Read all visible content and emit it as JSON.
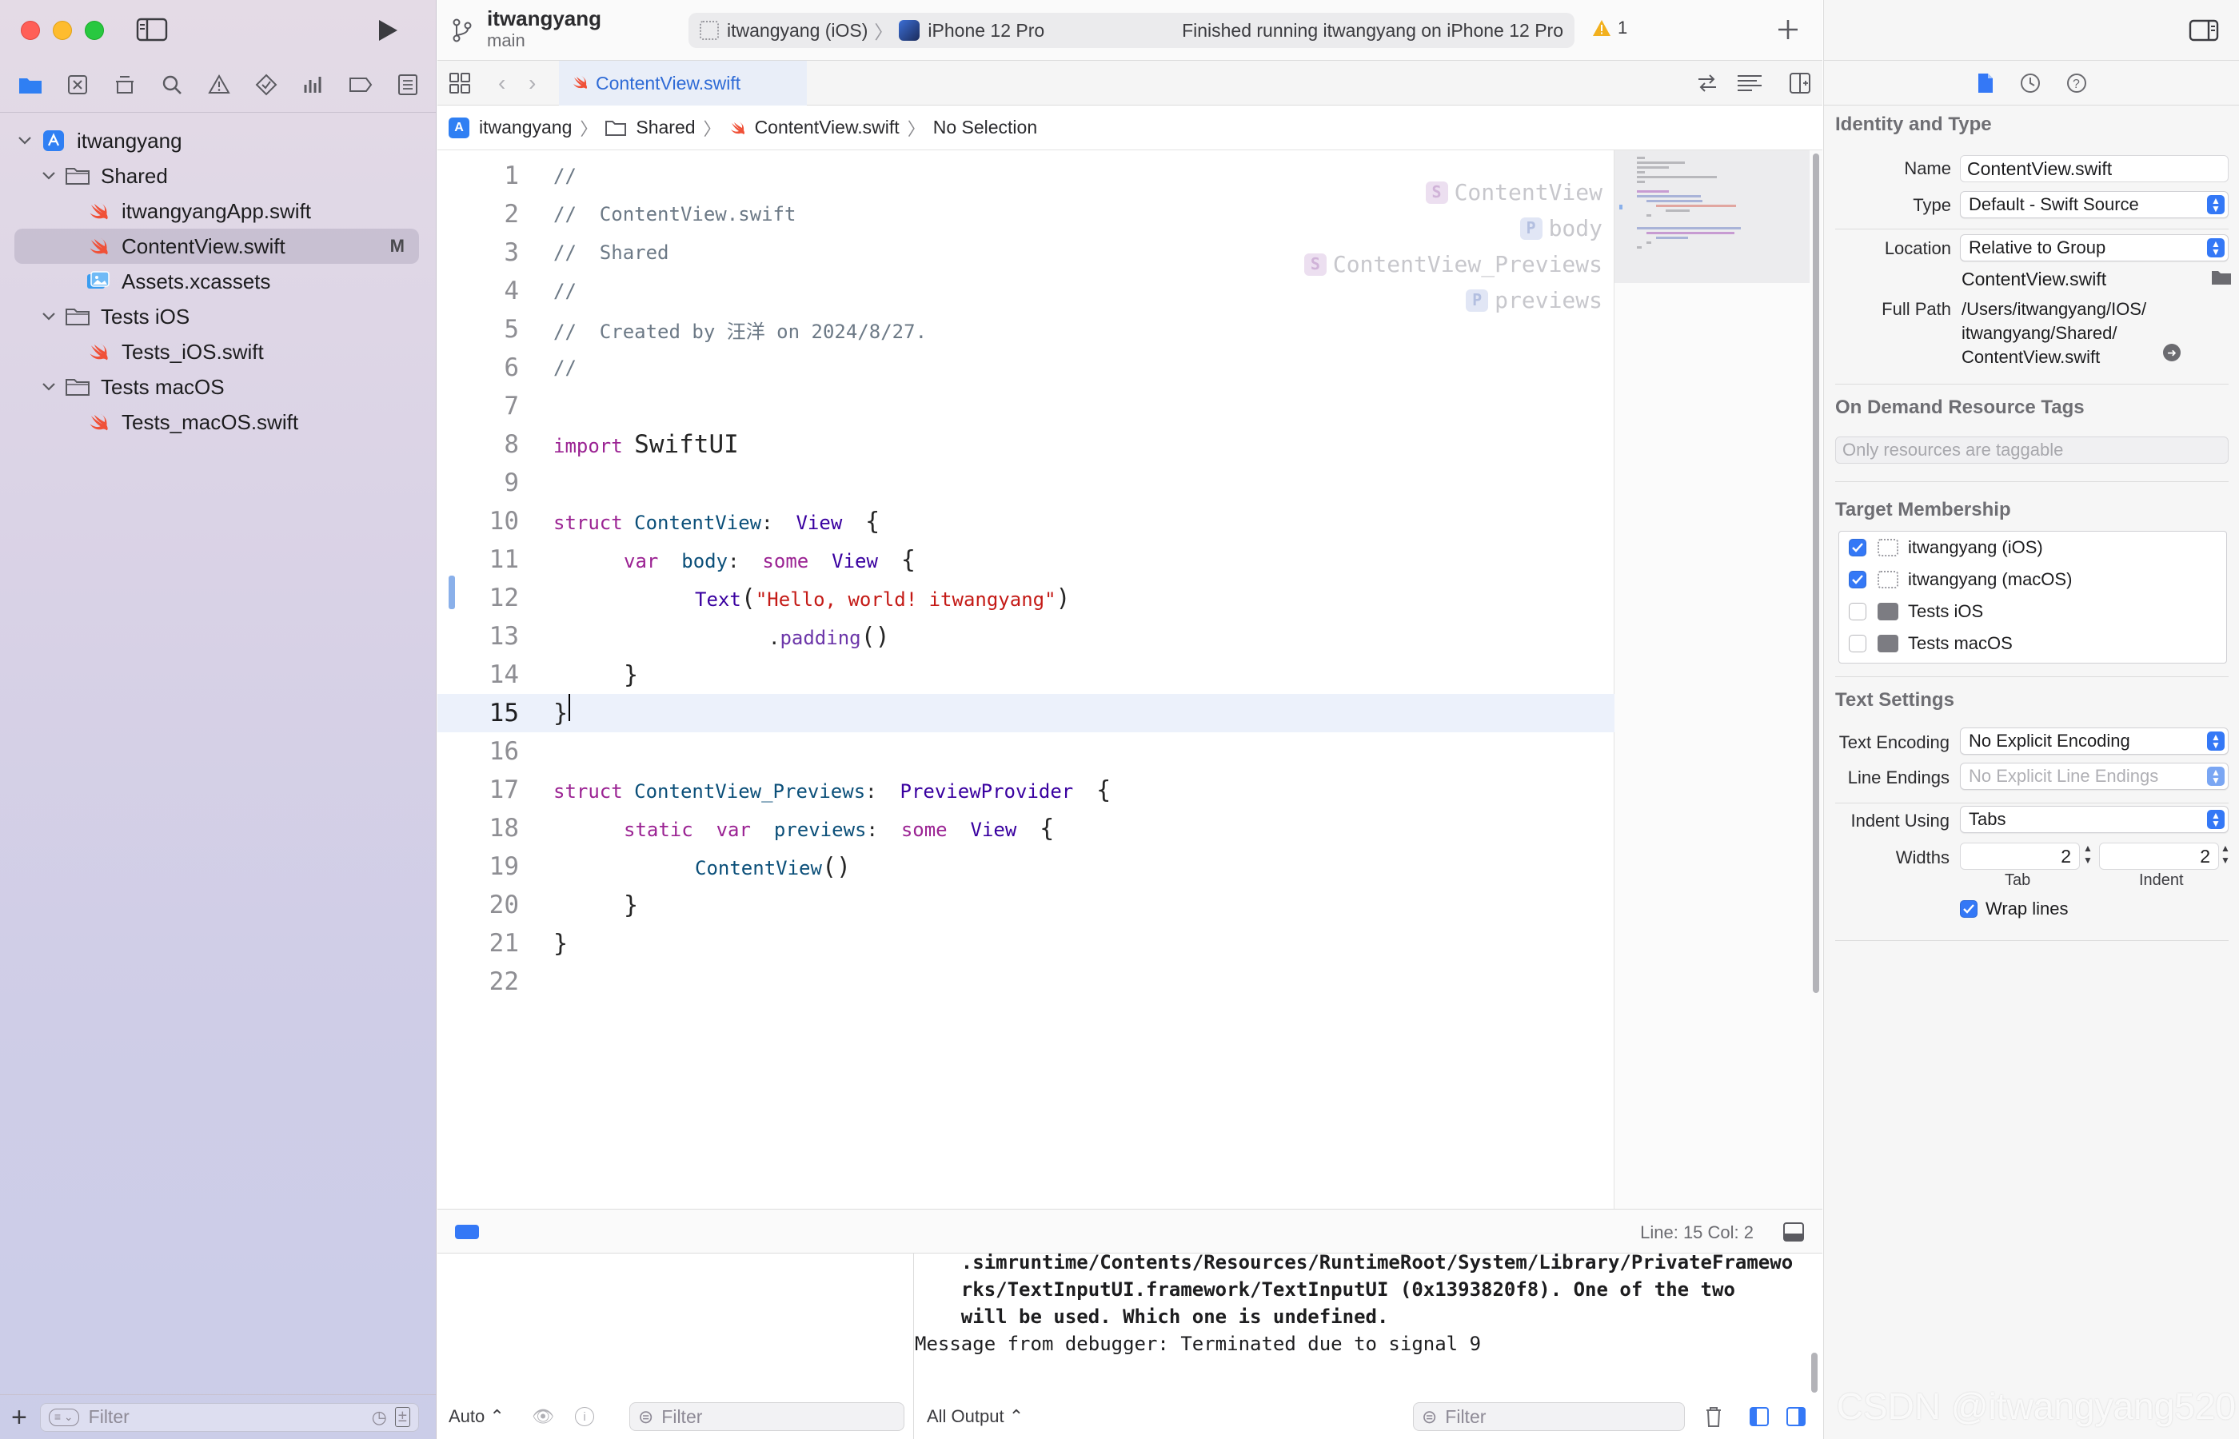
{
  "project": {
    "name": "itwangyang",
    "branch": "main"
  },
  "scheme": {
    "target": "itwangyang (iOS)",
    "device": "iPhone 12 Pro",
    "status": "Finished running itwangyang on iPhone 12 Pro",
    "warnings": "1"
  },
  "navigator": {
    "items": [
      {
        "label": "itwangyang",
        "icon": "project-icon",
        "level": 0
      },
      {
        "label": "Shared",
        "icon": "folder-icon",
        "level": 1
      },
      {
        "label": "itwangyangApp.swift",
        "icon": "swift-icon",
        "level": 2
      },
      {
        "label": "ContentView.swift",
        "icon": "swift-icon",
        "level": 2,
        "badge": "M",
        "selected": true
      },
      {
        "label": "Assets.xcassets",
        "icon": "assets-icon",
        "level": 2
      },
      {
        "label": "Tests iOS",
        "icon": "folder-icon",
        "level": 1
      },
      {
        "label": "Tests_iOS.swift",
        "icon": "swift-icon",
        "level": 2
      },
      {
        "label": "Tests macOS",
        "icon": "folder-icon",
        "level": 1
      },
      {
        "label": "Tests_macOS.swift",
        "icon": "swift-icon",
        "level": 2
      }
    ],
    "filter_placeholder": "Filter"
  },
  "editor": {
    "tab_label": "ContentView.swift",
    "breadcrumb": [
      "itwangyang",
      "Shared",
      "ContentView.swift",
      "No Selection"
    ],
    "line_numbers": [
      "1",
      "2",
      "3",
      "4",
      "5",
      "6",
      "7",
      "8",
      "9",
      "10",
      "11",
      "12",
      "13",
      "14",
      "15",
      "16",
      "17",
      "18",
      "19",
      "20",
      "21",
      "22"
    ],
    "code": {
      "l1": "//",
      "l2": "//  ContentView.swift",
      "l3": "//  Shared",
      "l4": "//",
      "l5": "//  Created by 汪洋 on 2024/8/27.",
      "l6": "//",
      "l8_kw": "import",
      "l8_mod": "SwiftUI",
      "kw_struct": "struct",
      "kw_var": "var",
      "kw_some": "some",
      "kw_static": "static",
      "t_view": "View",
      "t_contentview": "ContentView",
      "t_previews_struct": "ContentView_Previews",
      "t_previewprovider": "PreviewProvider",
      "p_body": "body",
      "p_previews": "previews",
      "f_text": "Text",
      "s_hello": "\"Hello, world! itwangyang\"",
      "m_padding": "padding"
    },
    "outline_ghost": [
      {
        "badge": "S",
        "label": "ContentView"
      },
      {
        "badge": "P",
        "label": "body"
      },
      {
        "badge": "S",
        "label": "ContentView_Previews"
      },
      {
        "badge": "P",
        "label": "previews"
      }
    ],
    "position": "Line: 15  Col: 2"
  },
  "debug": {
    "console_lines": [
      "    .simruntime/Contents/Resources/RuntimeRoot/System/Library/PrivateFramewo",
      "    rks/TextInputUI.framework/TextInputUI (0x1393820f8). One of the two",
      "    will be used. Which one is undefined.",
      "Message from debugger: Terminated due to signal 9"
    ],
    "auto_label": "Auto",
    "output_label": "All Output",
    "filter_placeholder": "Filter"
  },
  "inspector": {
    "identity_title": "Identity and Type",
    "name_label": "Name",
    "name_value": "ContentView.swift",
    "type_label": "Type",
    "type_value": "Default - Swift Source",
    "location_label": "Location",
    "location_value": "Relative to Group",
    "location_file": "ContentView.swift",
    "fullpath_label": "Full Path",
    "fullpath_lines": [
      "/Users/itwangyang/IOS/",
      "itwangyang/Shared/",
      "ContentView.swift"
    ],
    "ondemand_title": "On Demand Resource Tags",
    "ondemand_placeholder": "Only resources are taggable",
    "membership_title": "Target Membership",
    "members": [
      {
        "label": "itwangyang (iOS)",
        "checked": true
      },
      {
        "label": "itwangyang (macOS)",
        "checked": true
      },
      {
        "label": "Tests iOS",
        "checked": false
      },
      {
        "label": "Tests macOS",
        "checked": false
      }
    ],
    "text_title": "Text Settings",
    "encoding_label": "Text Encoding",
    "encoding_value": "No Explicit Encoding",
    "endings_label": "Line Endings",
    "endings_value": "No Explicit Line Endings",
    "indent_label": "Indent Using",
    "indent_value": "Tabs",
    "widths_label": "Widths",
    "tab_width": "2",
    "indent_width": "2",
    "tab_caption": "Tab",
    "indent_caption": "Indent",
    "wrap_label": "Wrap lines"
  },
  "watermark": "CSDN @itwangyang520",
  "colors": {
    "accent": "#3478f6",
    "keyword": "#9b2393",
    "string": "#c41a16",
    "comment": "#6c7986"
  }
}
